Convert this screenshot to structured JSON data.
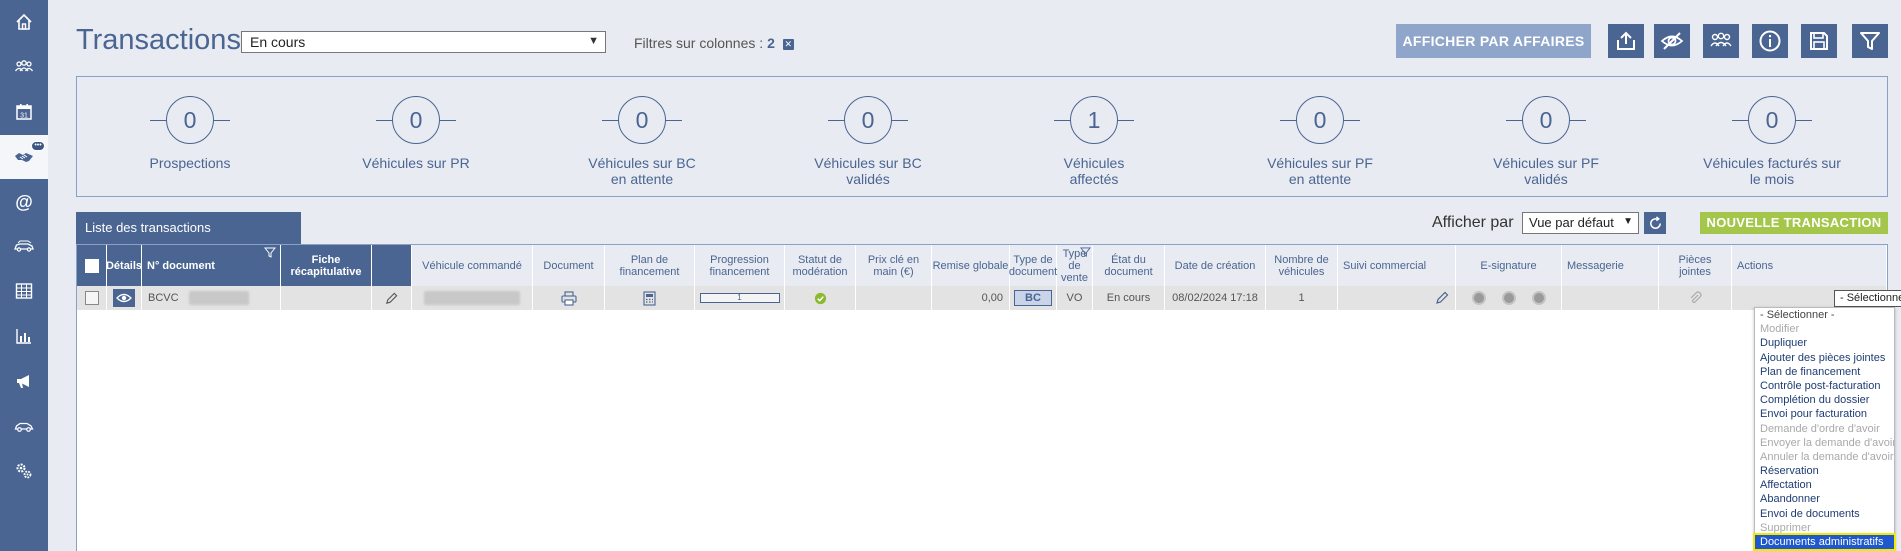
{
  "app": {
    "title": "Transactions",
    "status_value": "En cours",
    "filters_label": "Filtres sur colonnes :",
    "filters_count": "2",
    "filters_clear_glyph": "✕"
  },
  "toolbar": {
    "by_affairs_label": "AFFICHER PAR AFFAIRES",
    "icons": [
      "export-icon",
      "hide-icon",
      "group-icon",
      "info-icon",
      "save-icon",
      "filter-icon"
    ]
  },
  "sidebar": {
    "items": [
      {
        "icon": "home-icon"
      },
      {
        "icon": "people-icon"
      },
      {
        "icon": "calendar-icon"
      },
      {
        "icon": "handshake-icon",
        "active": true,
        "badge": "•••"
      },
      {
        "icon": "at-icon"
      },
      {
        "icon": "car-fleet-icon"
      },
      {
        "icon": "table-icon"
      },
      {
        "icon": "bar-chart-icon"
      },
      {
        "icon": "megaphone-icon"
      },
      {
        "icon": "car-icon"
      },
      {
        "icon": "settings-icon"
      }
    ],
    "calendar_day": "31"
  },
  "stats": [
    {
      "value": "0",
      "label": "Prospections"
    },
    {
      "value": "0",
      "label": "Véhicules sur PR"
    },
    {
      "value": "0",
      "label": "Véhicules sur BC en attente"
    },
    {
      "value": "0",
      "label": "Véhicules sur BC validés"
    },
    {
      "value": "1",
      "label": "Véhicules affectés"
    },
    {
      "value": "0",
      "label": "Véhicules sur PF en attente"
    },
    {
      "value": "0",
      "label": "Véhicules sur PF validés"
    },
    {
      "value": "0",
      "label": "Véhicules facturés sur le mois"
    }
  ],
  "list": {
    "tab_label": "Liste des transactions",
    "view_by_label": "Afficher par",
    "view_value": "Vue par défaut",
    "new_transaction_label": "NOUVELLE TRANSACTION"
  },
  "table": {
    "headers": {
      "details": "Détails",
      "doc_number": "N° document",
      "summary": "Fiche récapitulative",
      "vehicle": "Véhicule commandé",
      "document": "Document",
      "financing_plan": "Plan de financement",
      "financing_progress": "Progression financement",
      "moderation": "Statut de modération",
      "price": "Prix clé en main (€)",
      "discount": "Remise globale",
      "doc_type": "Type de document",
      "sale_type": "Type de vente",
      "doc_state": "État du document",
      "created": "Date de création",
      "vehicle_count": "Nombre de véhicules",
      "followup": "Suivi commercial",
      "esign": "E-signature",
      "messaging": "Messagerie",
      "attachments": "Pièces jointes",
      "actions": "Actions"
    },
    "row": {
      "doc_number": "BCVC",
      "progress_value": "1",
      "discount": "0,00",
      "doc_type": "BC",
      "sale_type": "VO",
      "doc_state": "En cours",
      "created": "08/02/2024 17:18",
      "vehicle_count": "1",
      "action_value": "- Sélectionner -"
    }
  },
  "actions_menu": [
    {
      "label": "- Sélectionner -",
      "state": "placeholder"
    },
    {
      "label": "Modifier",
      "state": "disabled"
    },
    {
      "label": "Dupliquer",
      "state": "enabled"
    },
    {
      "label": "Ajouter des pièces jointes",
      "state": "enabled"
    },
    {
      "label": "Plan de financement",
      "state": "enabled"
    },
    {
      "label": "Contrôle post-facturation",
      "state": "enabled"
    },
    {
      "label": "Complétion du dossier",
      "state": "enabled"
    },
    {
      "label": "Envoi pour facturation",
      "state": "enabled"
    },
    {
      "label": "Demande d'ordre d'avoir",
      "state": "disabled"
    },
    {
      "label": "Envoyer la demande d'avoir",
      "state": "disabled"
    },
    {
      "label": "Annuler la demande d'avoir",
      "state": "disabled"
    },
    {
      "label": "Réservation",
      "state": "enabled"
    },
    {
      "label": "Affectation",
      "state": "enabled"
    },
    {
      "label": "Abandonner",
      "state": "enabled"
    },
    {
      "label": "Envoi de documents",
      "state": "enabled"
    },
    {
      "label": "Supprimer",
      "state": "disabled"
    },
    {
      "label": "Documents administratifs",
      "state": "highlighted"
    }
  ],
  "colors": {
    "primary": "#4a6592",
    "muted_button": "#8fa5c9",
    "success": "#a4c64a",
    "page_bg": "#e8ebf1",
    "highlight": "#1e58cc",
    "highlight_outline": "#f4ea00"
  }
}
